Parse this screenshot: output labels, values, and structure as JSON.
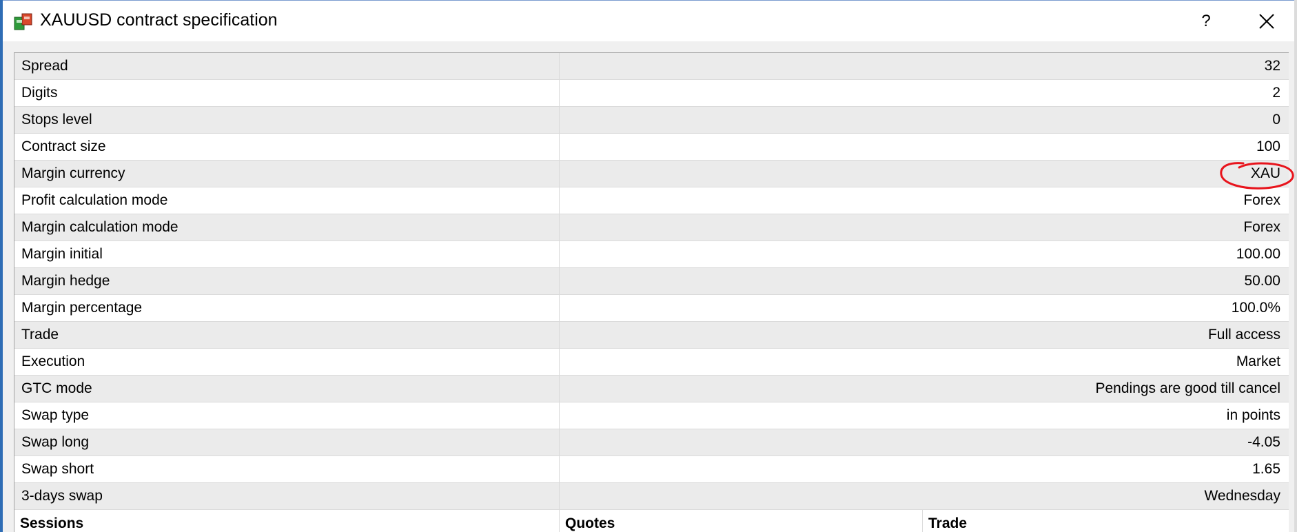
{
  "window": {
    "title": "XAUUSD contract specification",
    "help_label": "?",
    "icons": {
      "app": "market-symbol-icon",
      "close": "close-icon"
    }
  },
  "rows": [
    {
      "label": "Spread",
      "value": "32"
    },
    {
      "label": "Digits",
      "value": "2"
    },
    {
      "label": "Stops level",
      "value": "0"
    },
    {
      "label": "Contract size",
      "value": "100"
    },
    {
      "label": "Margin currency",
      "value": "XAU"
    },
    {
      "label": "Profit calculation mode",
      "value": "Forex"
    },
    {
      "label": "Margin calculation mode",
      "value": "Forex"
    },
    {
      "label": "Margin initial",
      "value": "100.00"
    },
    {
      "label": "Margin hedge",
      "value": "50.00"
    },
    {
      "label": "Margin percentage",
      "value": "100.0%"
    },
    {
      "label": "Trade",
      "value": "Full access"
    },
    {
      "label": "Execution",
      "value": "Market"
    },
    {
      "label": "GTC mode",
      "value": "Pendings are good till cancel"
    },
    {
      "label": "Swap type",
      "value": "in points"
    },
    {
      "label": "Swap long",
      "value": "-4.05"
    },
    {
      "label": "Swap short",
      "value": "1.65"
    },
    {
      "label": "3-days swap",
      "value": "Wednesday"
    }
  ],
  "sessions_header": {
    "sessions": "Sessions",
    "quotes": "Quotes",
    "trade": "Trade"
  },
  "colors": {
    "annotation": "#e8141c",
    "shaded_row": "#ebebeb"
  }
}
